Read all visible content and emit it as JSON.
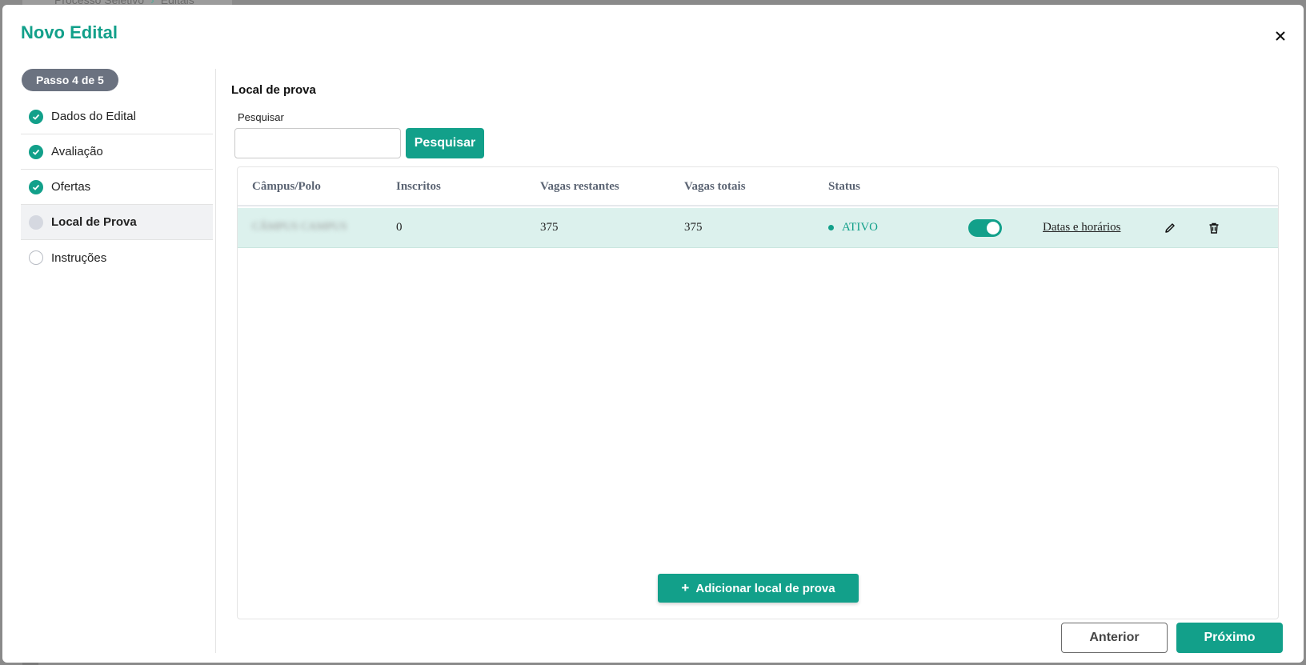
{
  "background": {
    "breadcrumb": [
      "Processo Seletivo",
      "Editais"
    ]
  },
  "modal": {
    "title": "Novo Edital",
    "close_icon": "close-icon"
  },
  "sidebar": {
    "step_indicator": "Passo 4 de 5",
    "steps": [
      {
        "label": "Dados do Edital",
        "state": "done"
      },
      {
        "label": "Avaliação",
        "state": "done"
      },
      {
        "label": "Ofertas",
        "state": "done"
      },
      {
        "label": "Local de Prova",
        "state": "current"
      },
      {
        "label": "Instruções",
        "state": "todo"
      }
    ]
  },
  "main": {
    "section_title": "Local de prova",
    "search": {
      "label": "Pesquisar",
      "value": "",
      "button_label": "Pesquisar"
    },
    "table": {
      "columns": [
        "Câmpus/Polo",
        "Inscritos",
        "Vagas restantes",
        "Vagas totais",
        "Status"
      ],
      "rows": [
        {
          "campus": "CÂMPUS CAMPUS",
          "inscritos": "0",
          "vagas_restantes": "375",
          "vagas_totais": "375",
          "status": "ATIVO",
          "active_toggle": true,
          "link_label": "Datas e horários"
        }
      ]
    },
    "add_button_label": "Adicionar local de prova"
  },
  "footer": {
    "prev_label": "Anterior",
    "next_label": "Próximo"
  },
  "colors": {
    "accent": "#12a08a",
    "row_highlight": "#dcf1ed",
    "step_pill": "#6b7280"
  }
}
